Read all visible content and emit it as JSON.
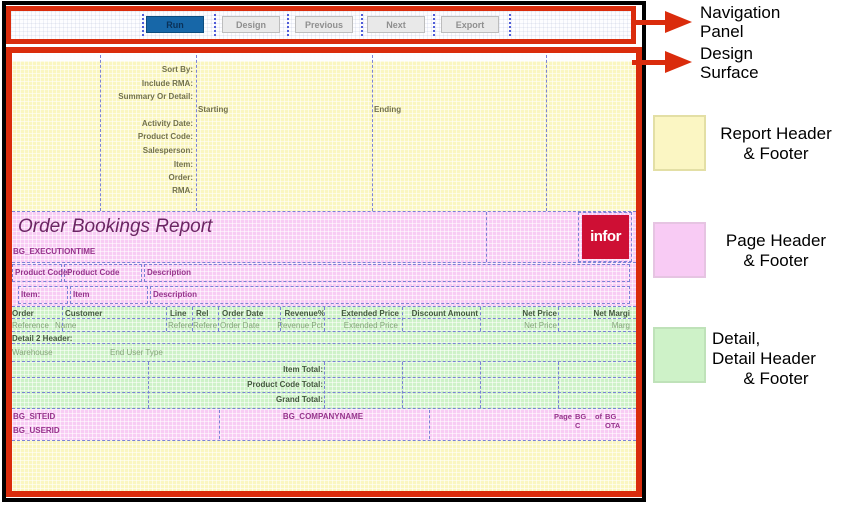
{
  "nav": {
    "buttons": [
      {
        "label": "Run"
      },
      {
        "label": "Design"
      },
      {
        "label": "Previous"
      },
      {
        "label": "Next"
      },
      {
        "label": "Export"
      }
    ]
  },
  "report": {
    "header": {
      "labels": [
        "Sort By:",
        "Include RMA:",
        "Summary Or Detail:",
        "Activity Date:",
        "Product Code:",
        "Salesperson:",
        "Item:",
        "Order:",
        "RMA:"
      ],
      "starting": "Starting",
      "ending": "Ending"
    },
    "page_header": {
      "title": "Order Bookings Report",
      "execution_time": "BG_EXECUTIONTIME",
      "logo": "infor",
      "product_row": {
        "label": "Product Code:",
        "field": "Product Code",
        "description": "Description"
      },
      "item_row": {
        "label": "Item:",
        "field": "Item",
        "description": "Description"
      }
    },
    "detail": {
      "header_cols": [
        "Order",
        "Customer",
        "Line",
        "Rel",
        "Order Date",
        "Revenue%",
        "Extended Price",
        "Discount Amount",
        "Net Price",
        "Net Margi"
      ],
      "field_cols": [
        "Reference",
        "Name",
        "Refere",
        "Refere",
        "Order Date",
        "Revenue Pct",
        "Extended Price",
        "Net Price",
        "Marg"
      ],
      "detail2_header": "Detail 2 Header:",
      "warehouse": "Warehouse",
      "end_user_type": "End User Type",
      "totals": [
        "Item Total:",
        "Product Code Total:",
        "Grand Total:"
      ]
    },
    "page_footer": {
      "site_id": "BG_SITEID",
      "user_id": "BG_USERID",
      "company": "BG_COMPANYNAME",
      "page_label": "Page",
      "page_field": "BG_C",
      "of_label": "of",
      "total_field": "BG_OTA"
    }
  },
  "annotations": {
    "nav_line1": "Navigation",
    "nav_line2": "Panel",
    "design_line1": "Design",
    "design_line2": "Surface",
    "legend": [
      {
        "color": "#FBF6C3",
        "line1": "Report Header",
        "line2": "& Footer"
      },
      {
        "color": "#F8CBF4",
        "line1": "Page Header",
        "line2": "& Footer"
      },
      {
        "color": "#CEF2C8",
        "line1": "Detail,",
        "line2": "Detail Header",
        "line3": "& Footer"
      }
    ]
  },
  "colors": {
    "annotation_red": "#DA2C0C",
    "report_header_band": "#FAF6C0",
    "page_header_band": "#F8CCF4",
    "detail_band": "#CEF2C8",
    "run_button_blue": "#1767A8",
    "infor_logo_red": "#CE0F34",
    "guide_dash_blue": "#7B82D6"
  }
}
